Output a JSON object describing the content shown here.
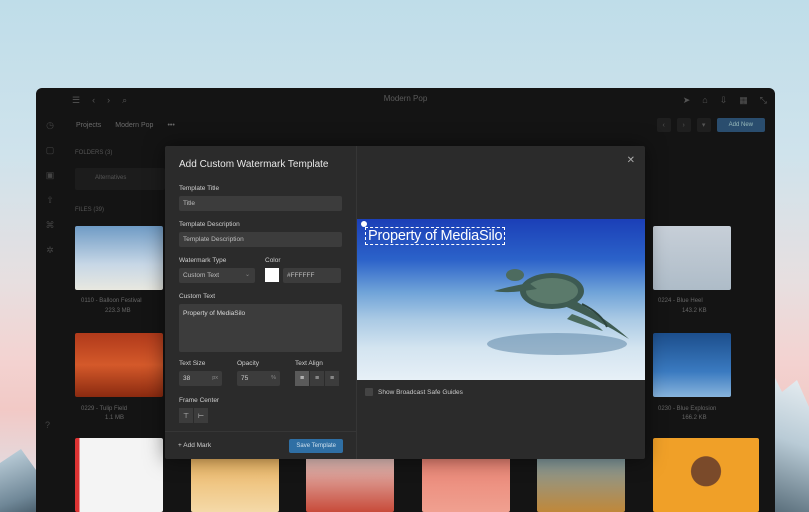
{
  "app": {
    "title": "Modern Pop"
  },
  "breadcrumb": {
    "projects": "Projects",
    "current": "Modern Pop",
    "more": "•••"
  },
  "toolbar": {
    "add_new": "Add New"
  },
  "sections": {
    "folders": "FOLDERS (3)",
    "files": "FILES (39)"
  },
  "folder": {
    "name": "Alternatives"
  },
  "tiles": [
    {
      "name": "0110 - Balloon Festival",
      "size": "223.3 MB"
    },
    {
      "name": "0229 - Tulip Field",
      "size": "1.1 MB"
    },
    {
      "name": "0224 - Blue Heel",
      "size": "143.2 KB"
    },
    {
      "name": "0230 - Blue Explosion",
      "size": "166.2 KB"
    }
  ],
  "modal": {
    "title": "Add Custom Watermark Template",
    "template_title_label": "Template Title",
    "template_title_placeholder": "Title",
    "template_desc_label": "Template Description",
    "template_desc_placeholder": "Template Description",
    "watermark_type_label": "Watermark Type",
    "watermark_type_value": "Custom Text",
    "color_label": "Color",
    "color_value": "#FFFFFF",
    "custom_text_label": "Custom Text",
    "custom_text_value": "Property of MediaSilo",
    "text_size_label": "Text Size",
    "text_size_value": "38",
    "text_size_unit": "px",
    "opacity_label": "Opacity",
    "opacity_value": "75",
    "opacity_unit": "%",
    "text_align_label": "Text Align",
    "frame_center_label": "Frame Center",
    "add_mark": "Add Mark",
    "save": "Save Template",
    "preview_watermark": "Property of MediaSilo",
    "broadcast_guides": "Show Broadcast Safe Guides"
  },
  "colors": {
    "accent": "#2f6fa4",
    "swatch": "#FFFFFF"
  }
}
